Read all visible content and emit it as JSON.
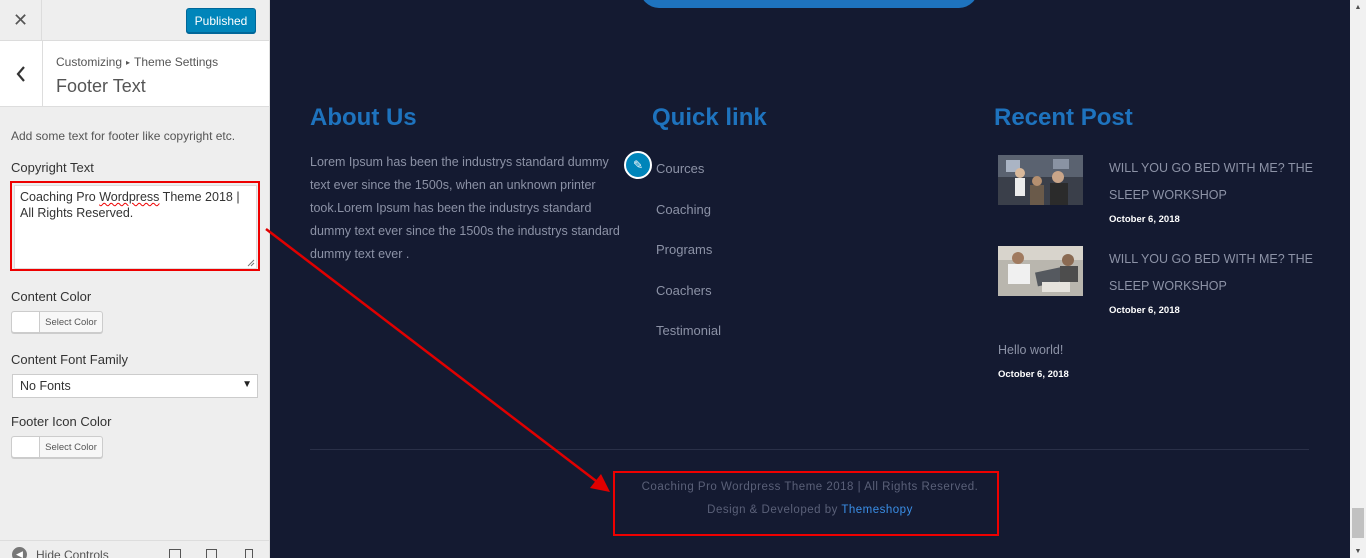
{
  "customizer": {
    "publish_label": "Published",
    "breadcrumb_root": "Customizing",
    "breadcrumb_parent": "Theme Settings",
    "section_title": "Footer Text",
    "description": "Add some text for footer like copyright etc.",
    "copyright_label": "Copyright Text",
    "copyright_value_pre": "Coaching Pro ",
    "copyright_value_spell": "Wordpress",
    "copyright_value_post": " Theme 2018 | All Rights Reserved.",
    "content_color_label": "Content Color",
    "select_color_label": "Select Color",
    "font_family_label": "Content Font Family",
    "font_family_value": "No Fonts",
    "footer_icon_color_label": "Footer Icon Color",
    "hide_controls_label": "Hide Controls"
  },
  "footer": {
    "about": {
      "title": "About Us",
      "text": "Lorem Ipsum has been the industrys standard dummy text ever since the 1500s, when an unknown printer took.Lorem Ipsum has been the industrys standard dummy text ever since the 1500s the industrys standard dummy text ever ."
    },
    "quick_links": {
      "title": "Quick link",
      "items": [
        "Cources",
        "Coaching",
        "Programs",
        "Coachers",
        "Testimonial"
      ]
    },
    "recent_posts": {
      "title": "Recent Post",
      "posts": [
        {
          "title": "WILL YOU GO BED WITH ME? THE SLEEP WORKSHOP",
          "date": "October 6, 2018"
        },
        {
          "title": "WILL YOU GO BED WITH ME? THE SLEEP WORKSHOP",
          "date": "October 6, 2018"
        }
      ],
      "hello_title": "Hello world!",
      "hello_date": "October 6, 2018"
    },
    "copyright_line": "Coaching Pro Wordpress Theme 2018 | All Rights Reserved.",
    "design_prefix": "Design & Developed by ",
    "design_link": "Themeshopy"
  },
  "colors": {
    "footer_bg": "#141a31",
    "accent": "#1e73be",
    "annotation": "#e00000"
  }
}
